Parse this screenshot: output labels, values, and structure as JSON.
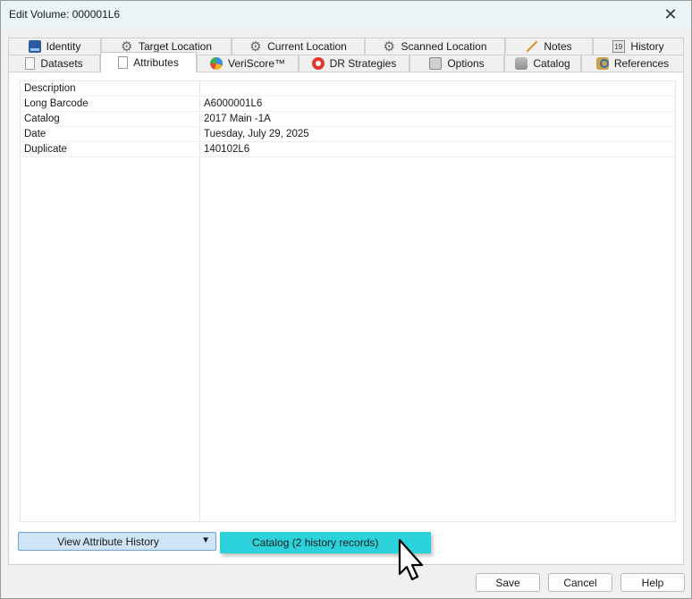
{
  "window": {
    "title": "Edit Volume: 000001L6",
    "close_glyph": "✕"
  },
  "tabs_row1": [
    {
      "label": "Identity",
      "icon": "identity-icon"
    },
    {
      "label": "Target Location",
      "icon": "gear-icon"
    },
    {
      "label": "Current Location",
      "icon": "gear-icon"
    },
    {
      "label": "Scanned Location",
      "icon": "gear-icon"
    },
    {
      "label": "Notes",
      "icon": "pencil-icon"
    },
    {
      "label": "History",
      "icon": "calendar-icon"
    }
  ],
  "tabs_row2": [
    {
      "label": "Datasets",
      "icon": "document-icon"
    },
    {
      "label": "Attributes",
      "icon": "page-icon",
      "active": true
    },
    {
      "label": "VeriScore™",
      "icon": "pie-chart-icon"
    },
    {
      "label": "DR Strategies",
      "icon": "life-ring-icon"
    },
    {
      "label": "Options",
      "icon": "lock-icon"
    },
    {
      "label": "Catalog",
      "icon": "database-icon"
    },
    {
      "label": "References",
      "icon": "references-icon"
    }
  ],
  "attributes": [
    {
      "name": "Description",
      "value": ""
    },
    {
      "name": "Long Barcode",
      "value": "A6000001L6"
    },
    {
      "name": "Catalog",
      "value": "2017 Main -1A"
    },
    {
      "name": "Date",
      "value": "Tuesday, July 29, 2025"
    },
    {
      "name": "Duplicate",
      "value": "140102L6"
    }
  ],
  "history_button": {
    "label": "View Attribute History",
    "arrow": "▼"
  },
  "history_menu": {
    "item": "Catalog (2 history records)"
  },
  "footer": {
    "save": "Save",
    "cancel": "Cancel",
    "help": "Help"
  },
  "colors": {
    "titlebar": "#eaf6f6",
    "menu_highlight": "#2bd2dc",
    "button_active": "#cfe4f7"
  }
}
